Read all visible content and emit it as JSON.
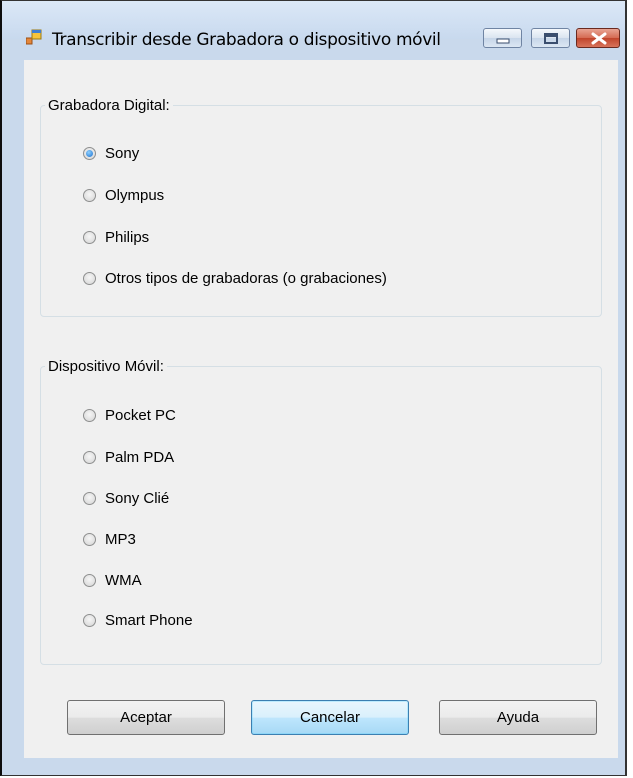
{
  "window": {
    "title": "Transcribir desde Grabadora o dispositivo móvil",
    "controls": [
      "minimize-icon",
      "maximize-icon",
      "close-icon"
    ]
  },
  "group_recorder": {
    "legend": "Grabadora Digital:",
    "options": [
      {
        "label": "Sony",
        "checked": true
      },
      {
        "label": "Olympus",
        "checked": false
      },
      {
        "label": "Philips",
        "checked": false
      },
      {
        "label": "Otros tipos de grabadoras (o grabaciones)",
        "checked": false
      }
    ]
  },
  "group_mobile": {
    "legend": "Dispositivo Móvil:",
    "options": [
      {
        "label": "Pocket PC",
        "checked": false
      },
      {
        "label": "Palm PDA",
        "checked": false
      },
      {
        "label": "Sony Clié",
        "checked": false
      },
      {
        "label": "MP3",
        "checked": false
      },
      {
        "label": "WMA",
        "checked": false
      },
      {
        "label": "Smart Phone",
        "checked": false
      }
    ]
  },
  "buttons": {
    "accept": "Aceptar",
    "cancel": "Cancelar",
    "help": "Ayuda"
  }
}
